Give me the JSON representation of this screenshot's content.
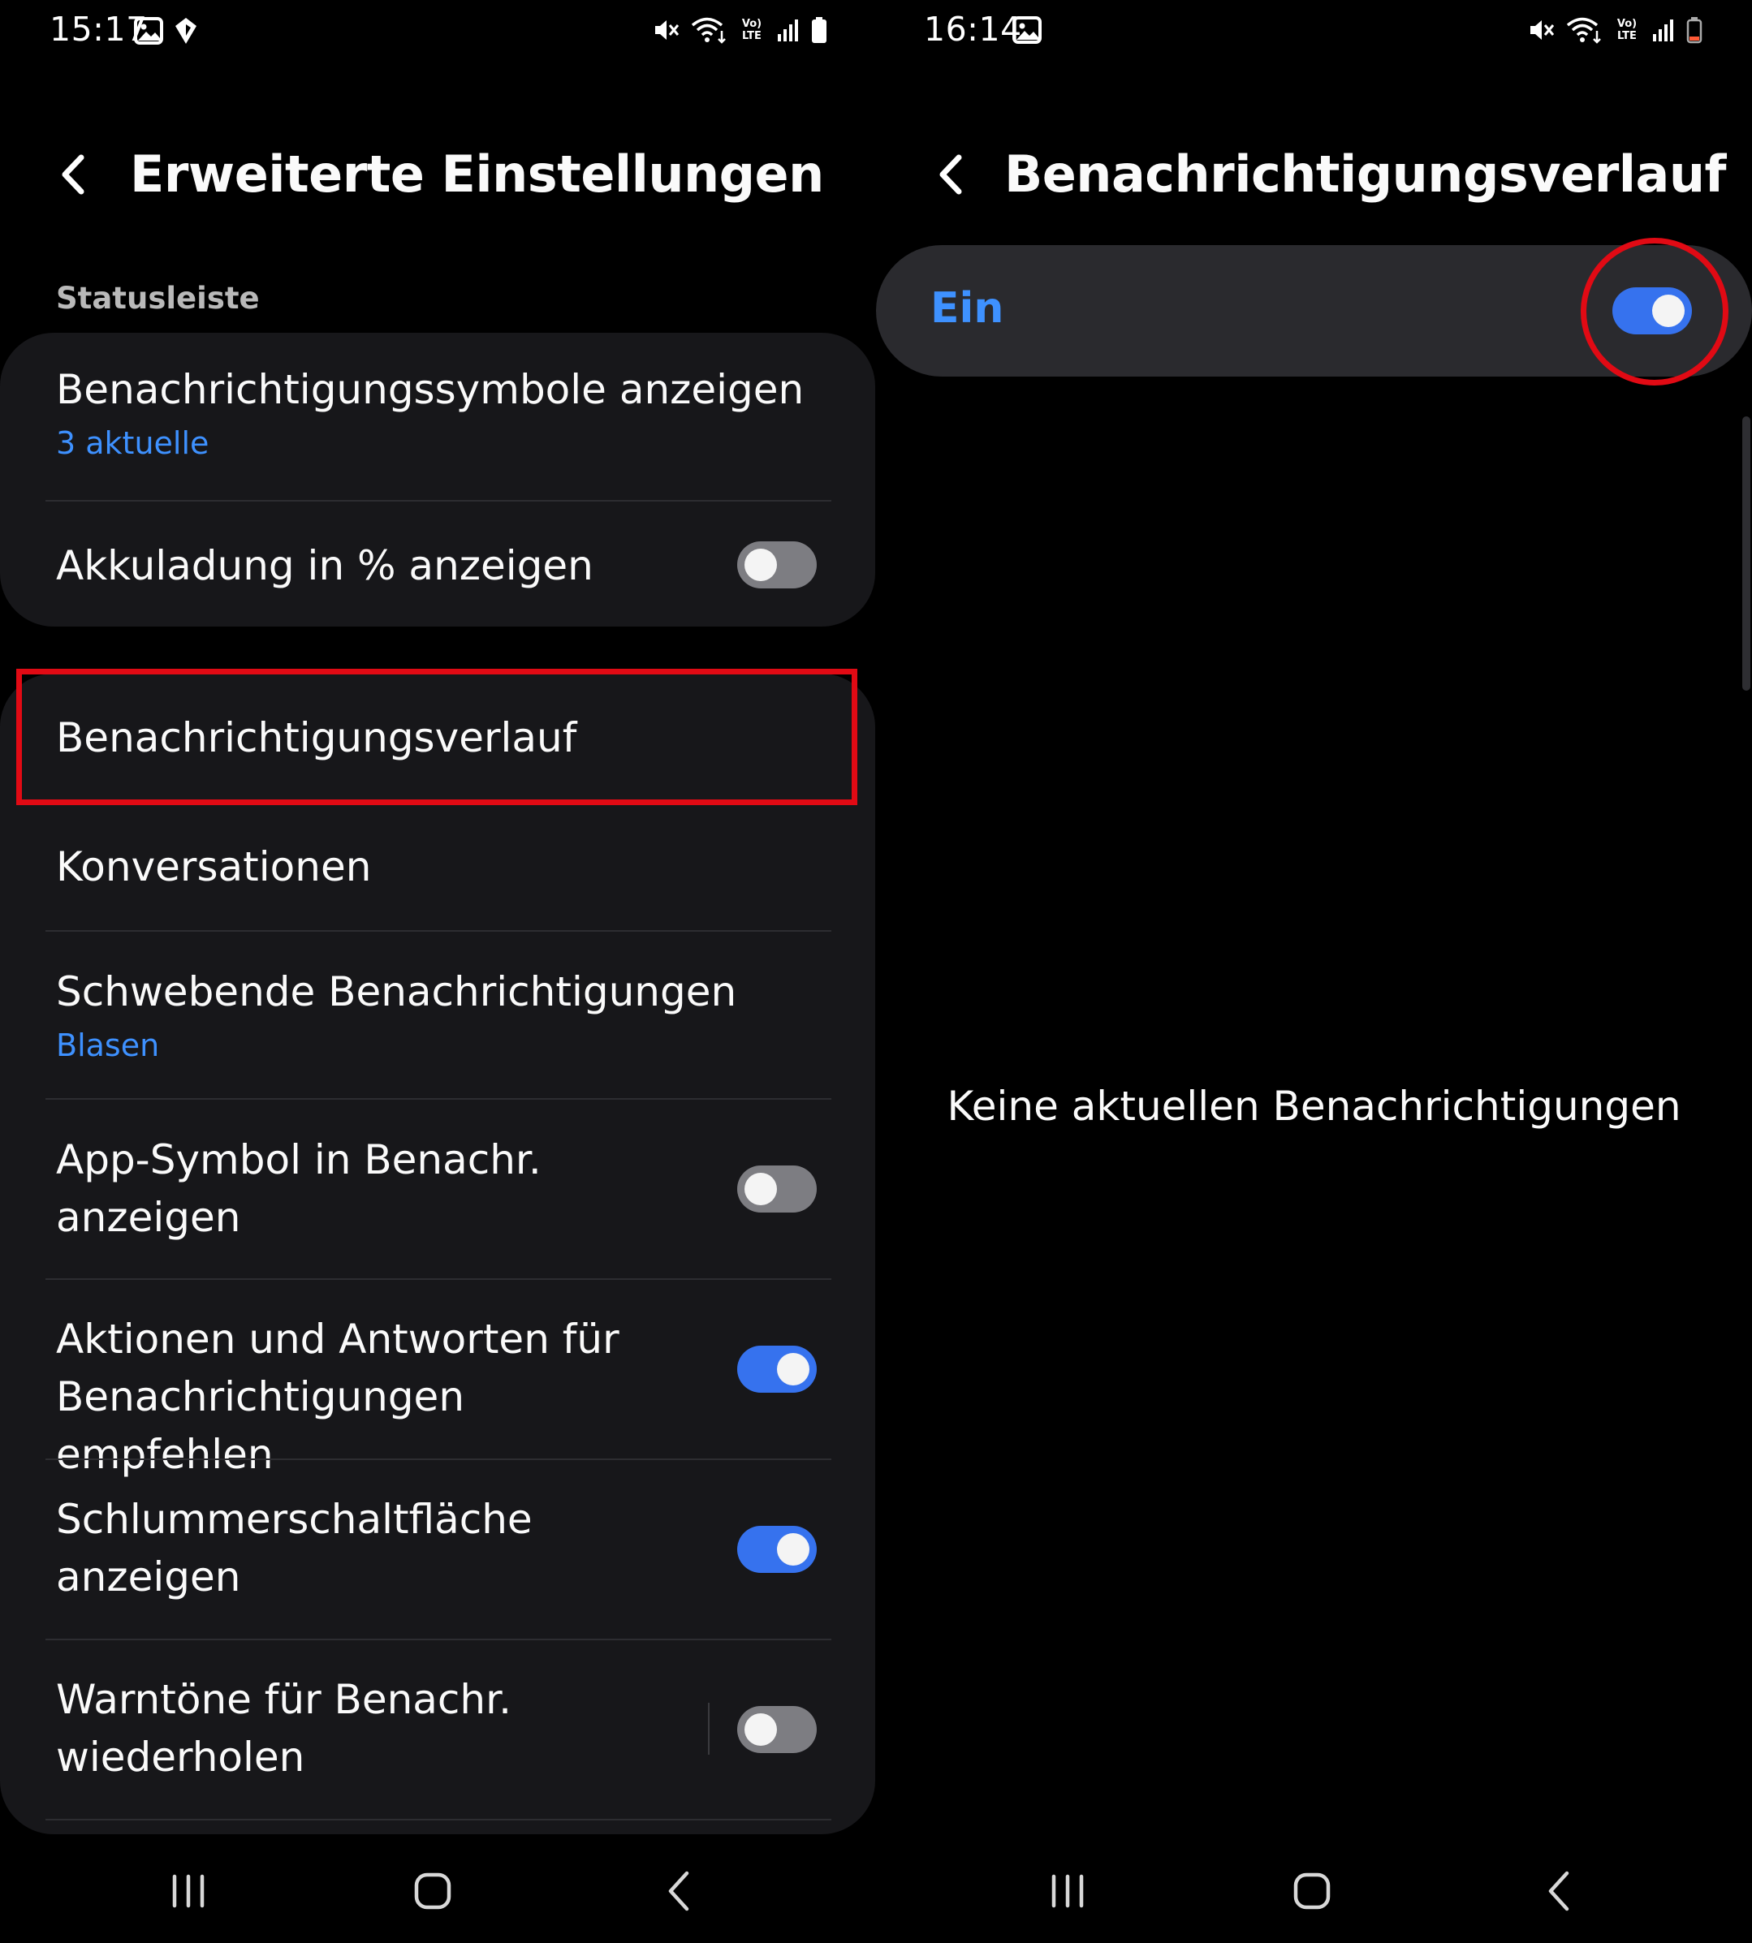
{
  "left": {
    "status_bar": {
      "time": "15:17",
      "left_icons": [
        "image-icon",
        "shield-icon"
      ],
      "right_icons": [
        "mute-icon",
        "wifi-icon",
        "volte-icon",
        "signal-icon",
        "battery-icon"
      ],
      "volte_top": "Vo)",
      "volte_bottom": "LTE"
    },
    "header": {
      "title": "Erweiterte Einstellungen"
    },
    "section_label": "Statusleiste",
    "items": [
      {
        "title": "Benachrichtigungssymbole anzeigen",
        "subtitle": "3 aktuelle"
      },
      {
        "title": "Akkuladung in % anzeigen",
        "toggle": false
      },
      {
        "title": "Benachrichtigungsverlauf"
      },
      {
        "title": "Konversationen"
      },
      {
        "title": "Schwebende Benachrichtigungen",
        "subtitle": "Blasen"
      },
      {
        "title_line1": "App-Symbol in Benachr.",
        "title_line2": "anzeigen",
        "toggle": false
      },
      {
        "title_line1": "Aktionen und Antworten für",
        "title_line2": "Benachrichtigungen empfehlen",
        "toggle": true
      },
      {
        "title_line1": "Schlummerschaltfläche",
        "title_line2": "anzeigen",
        "toggle": true
      },
      {
        "title_line1": "Warntöne für Benachr.",
        "title_line2": "wiederholen",
        "toggle": false
      }
    ]
  },
  "right": {
    "status_bar": {
      "time": "16:14",
      "left_icons": [
        "image-icon"
      ],
      "right_icons": [
        "mute-icon",
        "wifi-icon",
        "volte-icon",
        "signal-icon",
        "battery-low-icon"
      ],
      "volte_top": "Vo)",
      "volte_bottom": "LTE"
    },
    "header": {
      "title": "Benachrichtigungsverlauf"
    },
    "master_switch": {
      "label": "Ein",
      "toggle": true
    },
    "empty_message": "Keine aktuellen Benachrichtigungen"
  },
  "nav_icons": [
    "recent-apps-icon",
    "home-icon",
    "back-icon"
  ],
  "colors": {
    "accent": "#3e91ff",
    "toggle_on": "#3672ee",
    "toggle_off": "#7d7d82",
    "card": "#17171a",
    "highlight": "#e10a14"
  }
}
